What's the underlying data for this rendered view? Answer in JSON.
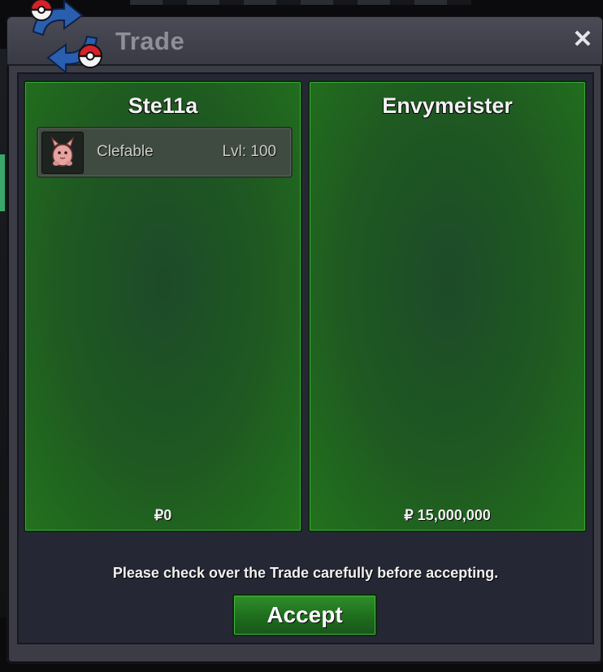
{
  "window": {
    "title": "Trade",
    "close_glyph": "✕",
    "logo_icon": "trade-arrows-pokeball-icon"
  },
  "trade": {
    "left_player": {
      "name": "Ste11a",
      "money": "₽0",
      "pokemon": [
        {
          "name": "Clefable",
          "level": "Lvl: 100",
          "icon": "clefable-sprite-icon"
        }
      ]
    },
    "right_player": {
      "name": "Envymeister",
      "money": "₽ 15,000,000",
      "pokemon": []
    },
    "notice": "Please check over the Trade carefully before accepting.",
    "accept_label": "Accept"
  },
  "colors": {
    "panel_green": "#22721d",
    "window_dark": "#262734",
    "accent_white": "#f2f2f2"
  }
}
